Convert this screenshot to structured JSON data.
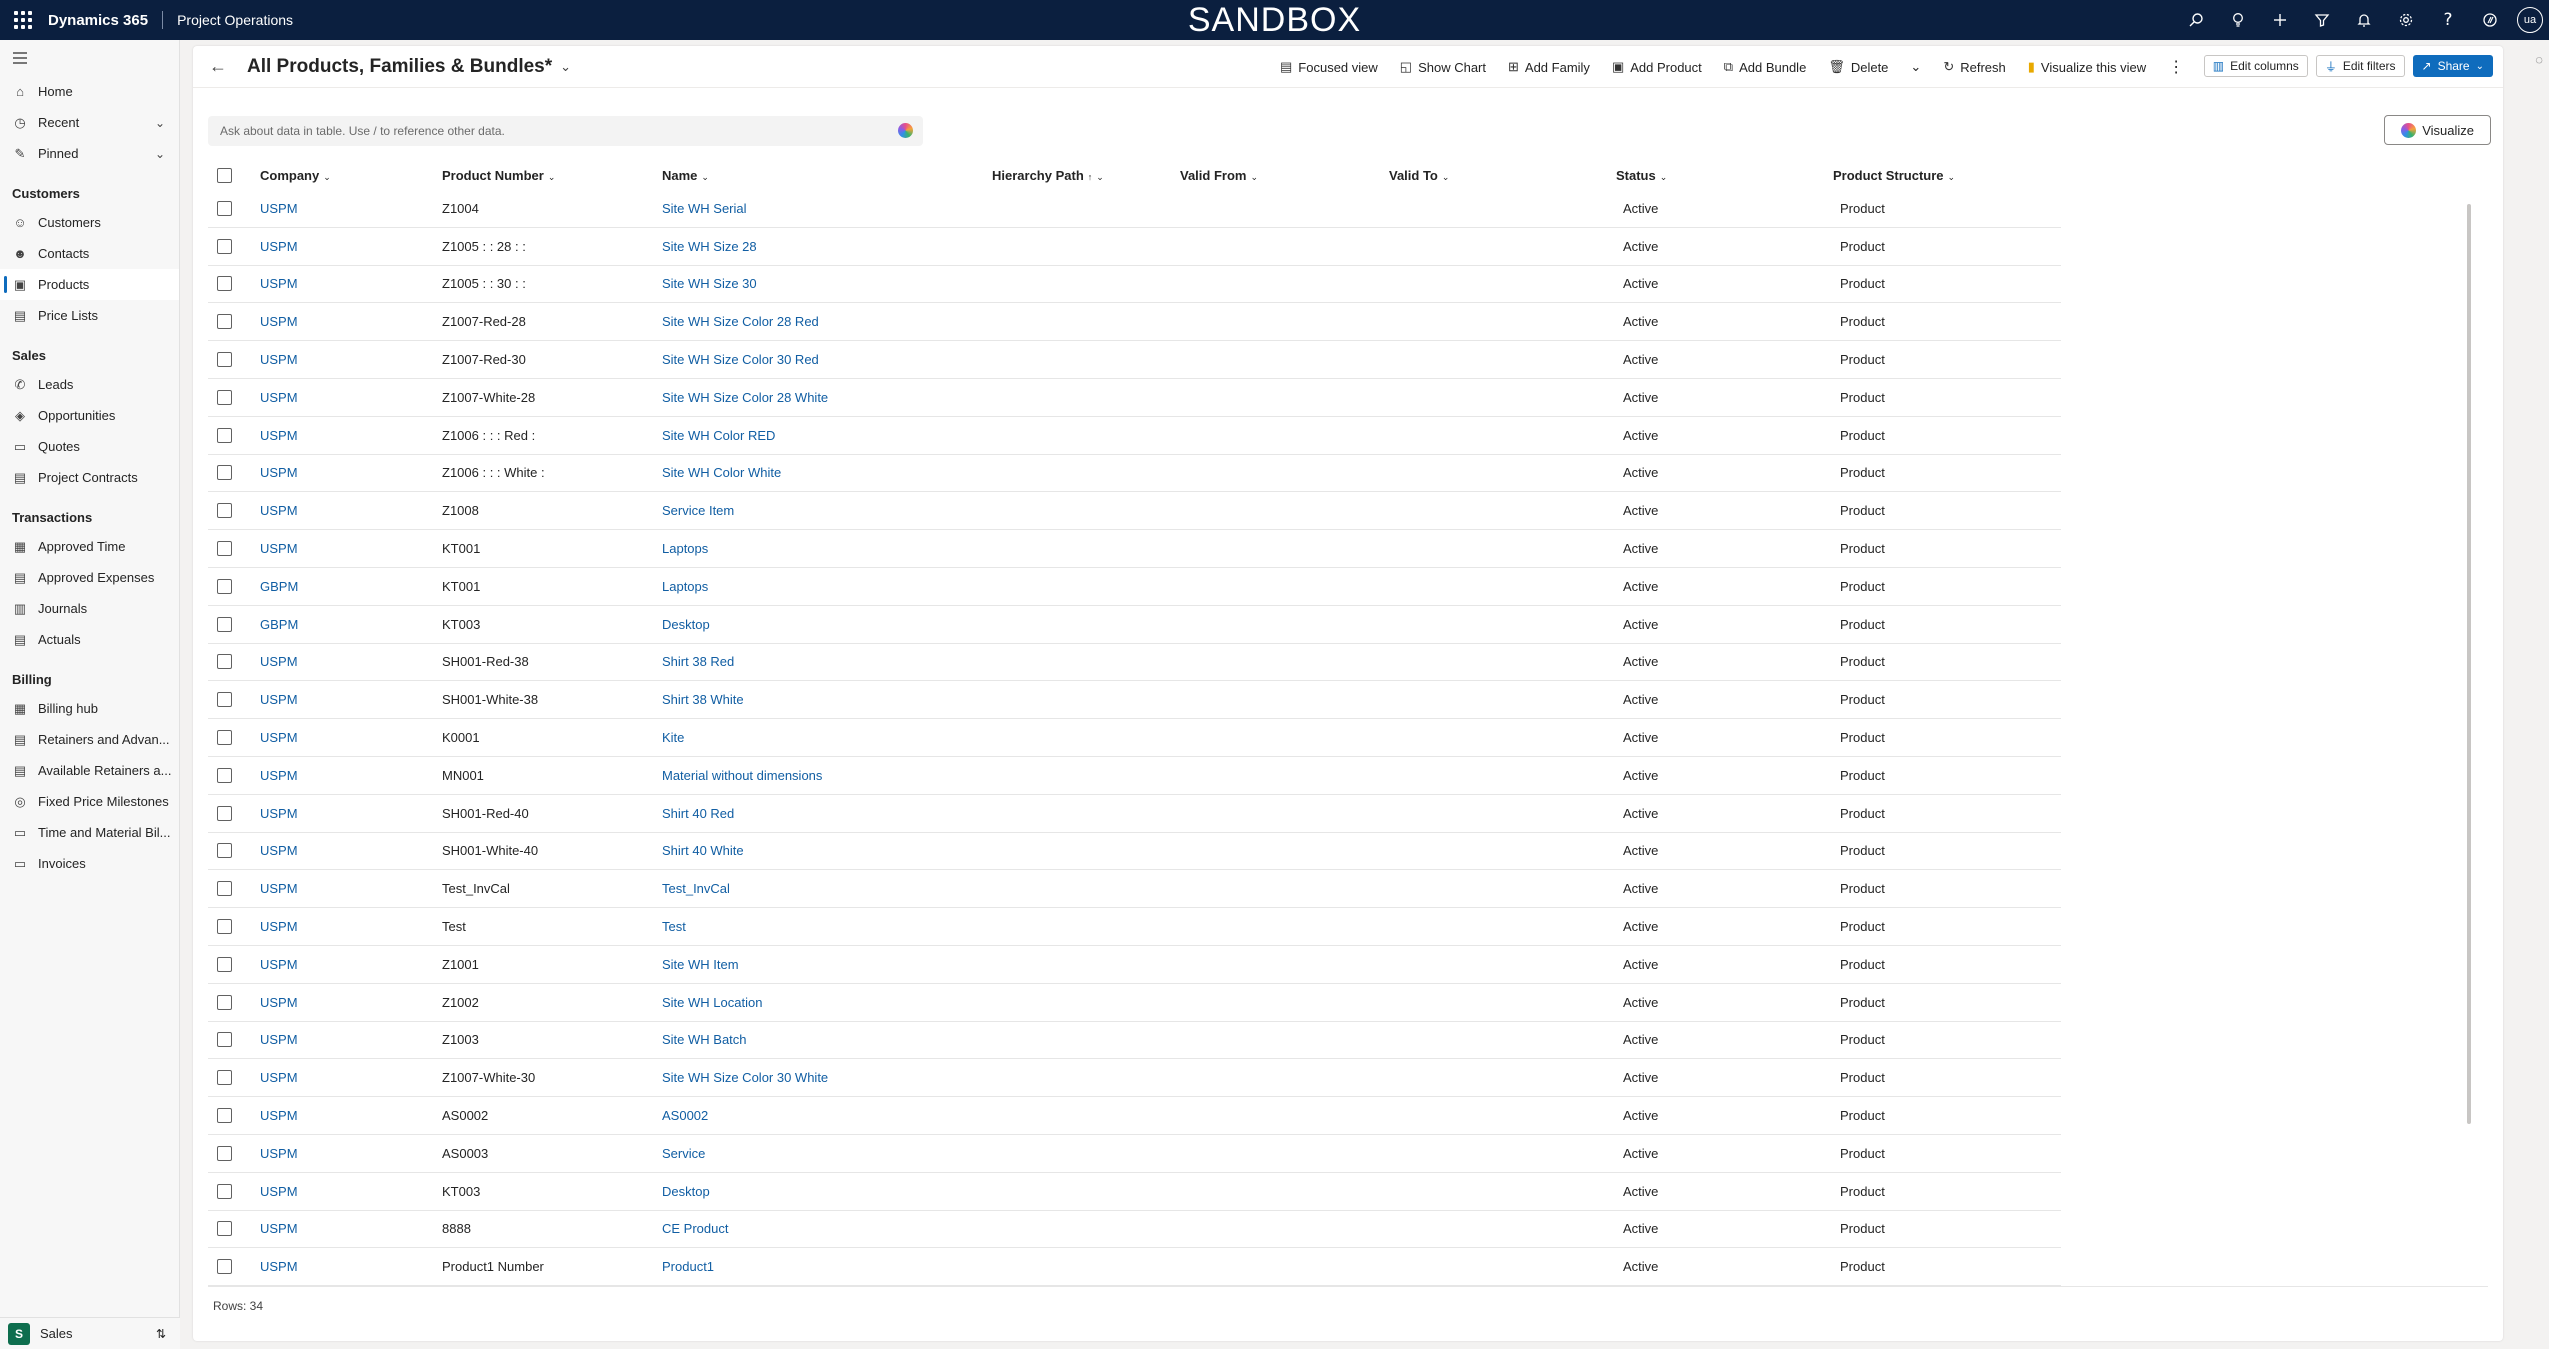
{
  "topbar": {
    "brand": "Dynamics 365",
    "app": "Project Operations",
    "environment": "SANDBOX",
    "user_initials": "ua",
    "icons": [
      "search-icon",
      "lightbulb-icon",
      "plus-icon",
      "filter-icon",
      "bell-icon",
      "settings-icon",
      "help-icon",
      "copilot-icon"
    ]
  },
  "sidebar": {
    "top": [
      {
        "label": "Home",
        "icon": "home-icon"
      },
      {
        "label": "Recent",
        "icon": "clock-icon"
      },
      {
        "label": "Pinned",
        "icon": "pin-icon"
      }
    ],
    "groups": [
      {
        "title": "Customers",
        "items": [
          "Customers",
          "Contacts",
          "Products",
          "Price Lists"
        ]
      },
      {
        "title": "Sales",
        "items": [
          "Leads",
          "Opportunities",
          "Quotes",
          "Project Contracts"
        ]
      },
      {
        "title": "Transactions",
        "items": [
          "Approved Time",
          "Approved Expenses",
          "Journals",
          "Actuals"
        ]
      },
      {
        "title": "Billing",
        "items": [
          "Billing hub",
          "Retainers and Advan...",
          "Available Retainers a...",
          "Fixed Price Milestones",
          "Time and Material Bil...",
          "Invoices"
        ]
      }
    ],
    "selected": "Products",
    "area": {
      "badge": "S",
      "label": "Sales"
    }
  },
  "view": {
    "title": "All Products, Families & Bundles*",
    "commands": [
      "Focused view",
      "Show Chart",
      "Add Family",
      "Add Product",
      "Add Bundle",
      "Delete",
      "Refresh",
      "Visualize this view"
    ],
    "edit_columns": "Edit columns",
    "edit_filters": "Edit filters",
    "share": "Share",
    "ask_placeholder": "Ask about data in table. Use / to reference other data.",
    "visualize": "Visualize"
  },
  "grid": {
    "columns": {
      "company": "Company",
      "number": "Product Number",
      "name": "Name",
      "hierarchy": "Hierarchy Path",
      "valid_from": "Valid From",
      "valid_to": "Valid To",
      "status": "Status",
      "structure": "Product Structure"
    },
    "rows": [
      {
        "company": "USPM",
        "number": "Z1004",
        "name": "Site WH Serial",
        "status": "Active",
        "structure": "Product"
      },
      {
        "company": "USPM",
        "number": "Z1005 : : 28 : :",
        "name": "Site WH Size 28",
        "status": "Active",
        "structure": "Product"
      },
      {
        "company": "USPM",
        "number": "Z1005 : : 30 : :",
        "name": "Site WH Size 30",
        "status": "Active",
        "structure": "Product"
      },
      {
        "company": "USPM",
        "number": "Z1007-Red-28",
        "name": "Site WH Size Color 28 Red",
        "status": "Active",
        "structure": "Product"
      },
      {
        "company": "USPM",
        "number": "Z1007-Red-30",
        "name": "Site WH Size Color 30 Red",
        "status": "Active",
        "structure": "Product"
      },
      {
        "company": "USPM",
        "number": "Z1007-White-28",
        "name": "Site WH Size Color 28 White",
        "status": "Active",
        "structure": "Product"
      },
      {
        "company": "USPM",
        "number": "Z1006 : : : Red :",
        "name": "Site WH Color RED",
        "status": "Active",
        "structure": "Product"
      },
      {
        "company": "USPM",
        "number": "Z1006 : : : White :",
        "name": "Site WH Color White",
        "status": "Active",
        "structure": "Product"
      },
      {
        "company": "USPM",
        "number": "Z1008",
        "name": "Service Item",
        "status": "Active",
        "structure": "Product"
      },
      {
        "company": "USPM",
        "number": "KT001",
        "name": "Laptops",
        "status": "Active",
        "structure": "Product"
      },
      {
        "company": "GBPM",
        "number": "KT001",
        "name": "Laptops",
        "status": "Active",
        "structure": "Product"
      },
      {
        "company": "GBPM",
        "number": "KT003",
        "name": "Desktop",
        "status": "Active",
        "structure": "Product"
      },
      {
        "company": "USPM",
        "number": "SH001-Red-38",
        "name": "Shirt 38 Red",
        "status": "Active",
        "structure": "Product"
      },
      {
        "company": "USPM",
        "number": "SH001-White-38",
        "name": "Shirt 38 White",
        "status": "Active",
        "structure": "Product"
      },
      {
        "company": "USPM",
        "number": "K0001",
        "name": "Kite",
        "status": "Active",
        "structure": "Product"
      },
      {
        "company": "USPM",
        "number": "MN001",
        "name": "Material without dimensions",
        "status": "Active",
        "structure": "Product"
      },
      {
        "company": "USPM",
        "number": "SH001-Red-40",
        "name": "Shirt 40 Red",
        "status": "Active",
        "structure": "Product"
      },
      {
        "company": "USPM",
        "number": "SH001-White-40",
        "name": "Shirt 40 White",
        "status": "Active",
        "structure": "Product"
      },
      {
        "company": "USPM",
        "number": "Test_InvCal",
        "name": "Test_InvCal",
        "status": "Active",
        "structure": "Product"
      },
      {
        "company": "USPM",
        "number": "Test",
        "name": "Test",
        "status": "Active",
        "structure": "Product"
      },
      {
        "company": "USPM",
        "number": "Z1001",
        "name": "Site WH Item",
        "status": "Active",
        "structure": "Product"
      },
      {
        "company": "USPM",
        "number": "Z1002",
        "name": "Site WH Location",
        "status": "Active",
        "structure": "Product"
      },
      {
        "company": "USPM",
        "number": "Z1003",
        "name": "Site WH Batch",
        "status": "Active",
        "structure": "Product"
      },
      {
        "company": "USPM",
        "number": "Z1007-White-30",
        "name": "Site WH Size Color 30 White",
        "status": "Active",
        "structure": "Product"
      },
      {
        "company": "USPM",
        "number": "AS0002",
        "name": "AS0002",
        "status": "Active",
        "structure": "Product"
      },
      {
        "company": "USPM",
        "number": "AS0003",
        "name": "Service",
        "status": "Active",
        "structure": "Product"
      },
      {
        "company": "USPM",
        "number": "KT003",
        "name": "Desktop",
        "status": "Active",
        "structure": "Product"
      },
      {
        "company": "USPM",
        "number": "8888",
        "name": "CE Product",
        "status": "Active",
        "structure": "Product"
      },
      {
        "company": "USPM",
        "number": "Product1 Number",
        "name": "Product1",
        "status": "Active",
        "structure": "Product"
      }
    ],
    "footer": "Rows: 34"
  },
  "colors": {
    "topbar": "#0b1f3f",
    "link": "#115ea3",
    "accent": "#0f6cbd",
    "area_badge": "#0e6e4e"
  }
}
